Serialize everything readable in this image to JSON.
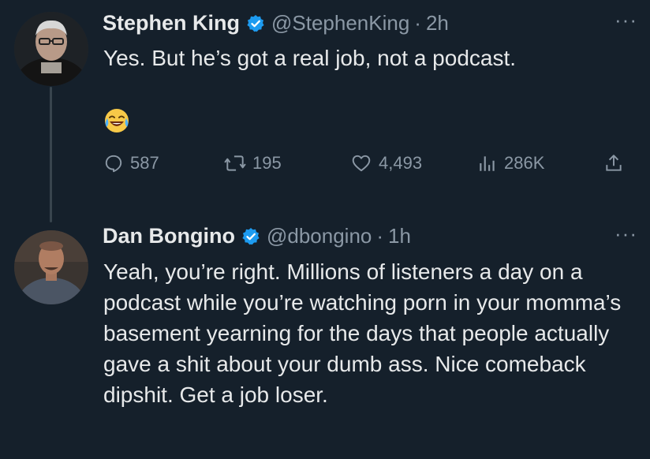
{
  "tweets": [
    {
      "display_name": "Stephen King",
      "handle": "@StephenKing",
      "separator": "·",
      "time": "2h",
      "text": "Yes. But he’s got a real job, not a podcast.",
      "emoji": "laughing-crying-face",
      "stats": {
        "replies": "587",
        "retweets": "195",
        "likes": "4,493",
        "views": "286K"
      }
    },
    {
      "display_name": "Dan Bongino",
      "handle": "@dbongino",
      "separator": "·",
      "time": "1h",
      "text": "Yeah, you’re right. Millions of listeners a day on a podcast while you’re watching porn in your momma’s basement yearning for the days that people actually gave a shit about your dumb ass. Nice comeback dipshit. Get a job loser."
    }
  ],
  "more_label": "···",
  "colors": {
    "background": "#15202b",
    "text": "#e7e9ea",
    "muted": "#8b98a5",
    "verified": "#1d9bf0",
    "thread_line": "#38444d"
  }
}
